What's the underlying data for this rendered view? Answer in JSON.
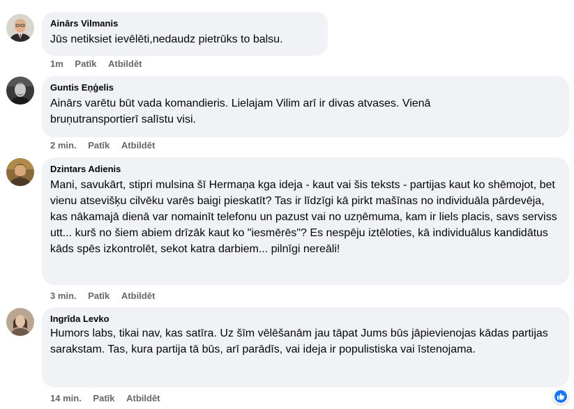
{
  "comments": [
    {
      "author": "Ainārs Vilmanis",
      "text": "Jūs netiksiet ievēlēti,nedaudz pietrūks to balsu.",
      "time": "1m",
      "like_label": "Patīk",
      "reply_label": "Atbildēt"
    },
    {
      "author": "Guntis Eņģelis",
      "text": "Ainārs varētu būt vada komandieris. Lielajam Vilim arī ir divas atvases. Vienā bruņutransportierī salīstu visi.",
      "time": "2 min.",
      "like_label": "Patīk",
      "reply_label": "Atbildēt"
    },
    {
      "author": "Dzintars Adienis",
      "text": "Mani, savukārt, stipri mulsina šī Hermaņa kga ideja - kaut vai šis teksts - partijas kaut ko shēmojot, bet vienu atsevišķu cilvēku varēs baigi pieskatīt? Tas ir līdzīgi kā pirkt mašīnas no individuāla pārdevēja, kas nākamajā dienā var nomainīt telefonu un pazust vai no uzņēmuma, kam ir liels placis, savs serviss utt... kurš no šiem abiem drīzāk kaut ko \"iesmērēs\"? Es nespēju iztēloties, kā individuālus kandidātus kāds spēs izkontrolēt, sekot katra darbiem... pilnīgi nereāli!",
      "time": "3 min.",
      "like_label": "Patīk",
      "reply_label": "Atbildēt"
    },
    {
      "author": "Ingrīda Levko",
      "text": "Humors labs, tikai nav, kas satīra. Uz šīm vēlēšanām jau tāpat Jums būs jāpievienojas kādas partijas sarakstam. Tas, kura partija tā būs, arī parādīs, vai ideja ir populistiska vai īstenojama.",
      "time": "14 min.",
      "like_label": "Patīk",
      "reply_label": "Atbildēt"
    }
  ],
  "reaction": {
    "icon": "thumbs-up-icon",
    "color": "#1877f2"
  }
}
